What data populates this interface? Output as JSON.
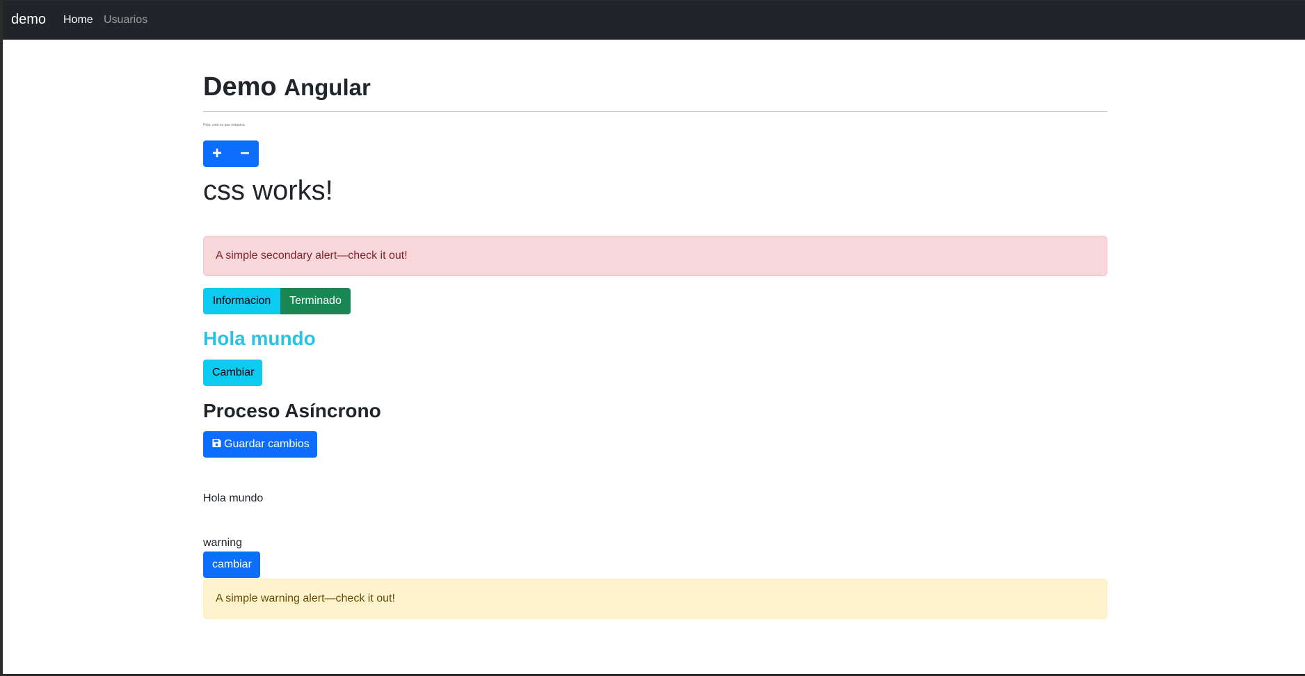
{
  "navbar": {
    "brand": "demo",
    "links": [
      {
        "label": "Home"
      },
      {
        "label": "Usuarios"
      }
    ]
  },
  "main": {
    "title": "Demo",
    "title_sub": "Angular",
    "tiny_text": "Hola, este es que máquina.",
    "counter": {
      "plus_label": "+",
      "minus_label": "−"
    },
    "css_works": "css works!",
    "alert_secondary": "A simple secondary alert—check it out!",
    "status_buttons": {
      "info_label": "Informacion",
      "done_label": "Terminado"
    },
    "hola_title": "Hola mundo",
    "cambiar_label": "Cambiar",
    "proceso_title": "Proceso Asíncrono",
    "guardar_label": "Guardar cambios",
    "hola_text": "Hola mundo",
    "warning_text": "warning",
    "cambiar2_label": "cambiar",
    "alert_warning": "A simple warning alert—check it out!"
  },
  "colors": {
    "navbar_bg": "#212529",
    "primary": "#0d6efd",
    "info": "#0dcaf0",
    "success": "#198754",
    "danger_alert_bg": "#f8d7da",
    "warning_alert_bg": "#fff3cd",
    "hola_title": "#2cc3e3"
  }
}
